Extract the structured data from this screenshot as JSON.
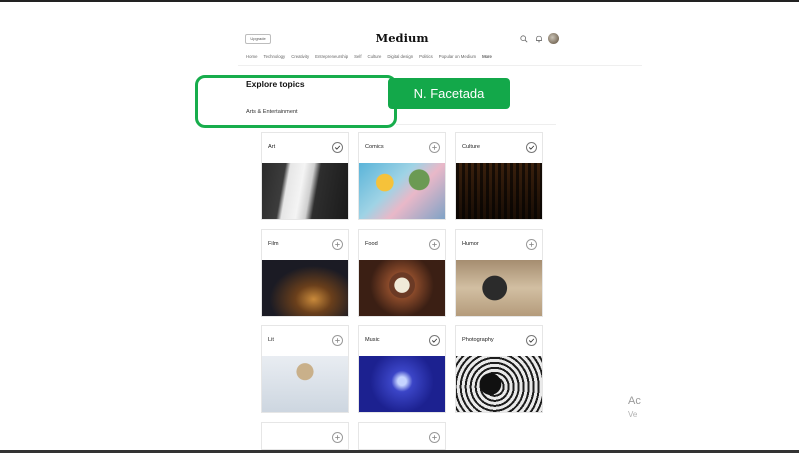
{
  "header": {
    "upgrade_label": "Upgrade",
    "logo": "Medium",
    "icons": [
      "search-icon",
      "bell-icon",
      "avatar"
    ]
  },
  "nav": {
    "items": [
      "Home",
      "Technology",
      "Creativity",
      "Entrepreneurship",
      "Self",
      "Culture",
      "Digital design",
      "Politics",
      "Popular on Medium",
      "More"
    ]
  },
  "page": {
    "title": "Explore topics",
    "section_label": "Arts & Entertainment"
  },
  "overlay": {
    "badge_label": "N. Facetada",
    "highlight_color": "#17ad4c",
    "badge_color": "#13a84a"
  },
  "topics": [
    {
      "label": "Art",
      "state": "followed"
    },
    {
      "label": "Comics",
      "state": "follow"
    },
    {
      "label": "Culture",
      "state": "followed"
    },
    {
      "label": "Film",
      "state": "follow"
    },
    {
      "label": "Food",
      "state": "follow"
    },
    {
      "label": "Humor",
      "state": "follow"
    },
    {
      "label": "Lit",
      "state": "follow"
    },
    {
      "label": "Music",
      "state": "followed"
    },
    {
      "label": "Photography",
      "state": "followed"
    }
  ],
  "side_watermark": {
    "line1": "Ac",
    "line2": "Ve"
  }
}
